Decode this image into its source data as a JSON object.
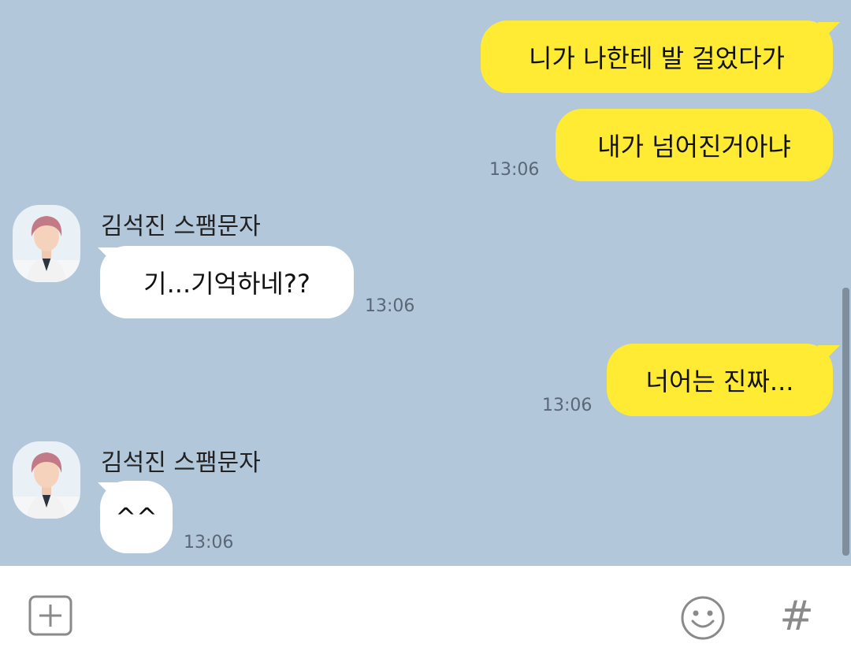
{
  "chat": {
    "messages": [
      {
        "text": "니가 나한테 발 걸었다가"
      },
      {
        "text": "내가 넘어진거아냐",
        "time": "13:06"
      },
      {
        "sender": "김석진 스팸문자",
        "text": "기...기억하네??",
        "time": "13:06"
      },
      {
        "text": "너어는 진짜...",
        "time": "13:06"
      },
      {
        "sender": "김석진 스팸문자",
        "text": "^^",
        "time": "13:06"
      }
    ]
  },
  "input_bar": {
    "icons": [
      "plus-box-icon",
      "emoji-icon",
      "hash-icon"
    ],
    "hash_glyph": "#"
  },
  "colors": {
    "background": "#b2c7da",
    "my_bubble": "#ffeb33",
    "their_bubble": "#ffffff"
  }
}
